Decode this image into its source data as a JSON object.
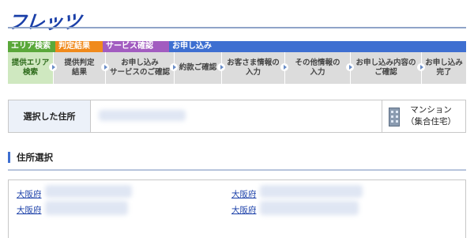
{
  "header": {
    "logo": "フレッツ"
  },
  "phases": [
    {
      "label": "エリア検索",
      "color": "#5aa83a"
    },
    {
      "label": "判定結果",
      "color": "#f08a1c"
    },
    {
      "label": "サービス確認",
      "color": "#a25cc0"
    },
    {
      "label": "お申し込み",
      "color": "#3e6fd1"
    }
  ],
  "steps": [
    {
      "label": "提供エリア\n検索"
    },
    {
      "label": "提供判定\n結果"
    },
    {
      "label": "お申し込み\nサービスのご確認"
    },
    {
      "label": "約款ご確認"
    },
    {
      "label": "お客さま情報の\n入力"
    },
    {
      "label": "その他情報の\n入力"
    },
    {
      "label": "お申し込み内容の\nご確認"
    },
    {
      "label": "お申し込み\n完了"
    }
  ],
  "selected_address": {
    "label": "選択した住所",
    "type_line1": "マンション",
    "type_line2": "（集合住宅）",
    "type_icon": "building-icon"
  },
  "section": {
    "title": "住所選択"
  },
  "address_links": [
    {
      "label": "大阪府"
    },
    {
      "label": "大阪府"
    },
    {
      "label": "大阪府"
    },
    {
      "label": "大阪府"
    }
  ]
}
